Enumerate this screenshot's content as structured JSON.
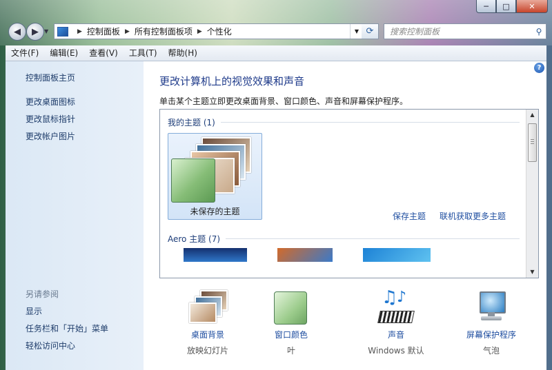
{
  "window": {
    "caption": {
      "minimize": "─",
      "maximize": "□",
      "close": "✕"
    }
  },
  "nav": {
    "back_icon": "back-arrow-icon",
    "forward_icon": "forward-arrow-icon",
    "breadcrumbs": [
      "控制面板",
      "所有控制面板项",
      "个性化"
    ],
    "search_placeholder": "搜索控制面板"
  },
  "menu": [
    "文件(F)",
    "编辑(E)",
    "查看(V)",
    "工具(T)",
    "帮助(H)"
  ],
  "sidebar": {
    "home": "控制面板主页",
    "links": [
      "更改桌面图标",
      "更改鼠标指针",
      "更改帐户图片"
    ],
    "see_also_heading": "另请参阅",
    "see_also": [
      "显示",
      "任务栏和「开始」菜单",
      "轻松访问中心"
    ]
  },
  "main": {
    "title": "更改计算机上的视觉效果和声音",
    "subtitle": "单击某个主题立即更改桌面背景、窗口颜色、声音和屏幕保护程序。",
    "my_themes_heading": "我的主题 (1)",
    "unsaved_theme": "未保存的主题",
    "save_theme": "保存主题",
    "get_more_online": "联机获取更多主题",
    "aero_heading": "Aero 主题 (7)"
  },
  "bottom": [
    {
      "title": "桌面背景",
      "value": "放映幻灯片",
      "icon": "desktop-background-icon"
    },
    {
      "title": "窗口颜色",
      "value": "叶",
      "icon": "window-color-icon"
    },
    {
      "title": "声音",
      "value": "Windows 默认",
      "icon": "sound-icon"
    },
    {
      "title": "屏幕保护程序",
      "value": "气泡",
      "icon": "screensaver-icon"
    }
  ],
  "colors": {
    "link": "#1f4ea0",
    "title": "#1e3a8a",
    "selection": "#d3e4f7",
    "sidebar": "#dbe8f5"
  }
}
